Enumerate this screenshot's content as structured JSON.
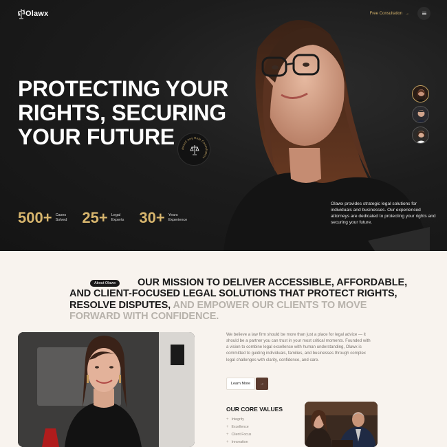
{
  "header": {
    "logo_text": "Olawx",
    "consultation_label": "Free Consultation",
    "consultation_arrow": "→",
    "menu_icon": "menu-icon"
  },
  "hero": {
    "title_lines": [
      "PROTECTING YOUR",
      "RIGHTS, SECURING",
      "YOUR FUTURE"
    ],
    "badge_text": "Award Any Help Consultation",
    "stats": [
      {
        "number": "500+",
        "label_1": "Cases",
        "label_2": "Solved"
      },
      {
        "number": "25+",
        "label_1": "Legal",
        "label_2": "Experts"
      },
      {
        "number": "30+",
        "label_1": "Years",
        "label_2": "Experience"
      }
    ],
    "description": "Olawx provides strategic legal solutions for individuals and businesses. Our experienced attorneys are dedicated to protecting your rights and securing your future."
  },
  "about": {
    "pill": "About Olawx",
    "mission_line_1": "OUR MISSION TO DELIVER ACCESSIBLE, AFFORDABLE,",
    "mission_line_2": "AND CLIENT-FOCUSED LEGAL SOLUTIONS THAT PROTECT RIGHTS,",
    "mission_line_3a": "RESOLVE DISPUTES,",
    "mission_line_3b": " AND EMPOWER OUR CLIENTS TO MOVE",
    "mission_line_4": "FORWARD WITH CONFIDENCE.",
    "body": "We believe a law firm should be more than just a place for legal advice — it should be a partner you can trust in your most critical moments. Founded with a vision to combine legal excellence with human understanding, Olawx is committed to guiding individuals, families, and businesses through complex legal challenges with clarity, confidence, and care.",
    "learn_more": "Learn More",
    "learn_arrow": "→",
    "values_title": "OUR CORE VALUES",
    "values": [
      "Integrity",
      "Excellence",
      "Client Focus",
      "Innovation"
    ]
  },
  "colors": {
    "accent_gold": "#d7b56d",
    "hero_bg": "#1c1c1c",
    "page_bg": "#f8f3ee",
    "button_brown": "#5a3a2e"
  }
}
